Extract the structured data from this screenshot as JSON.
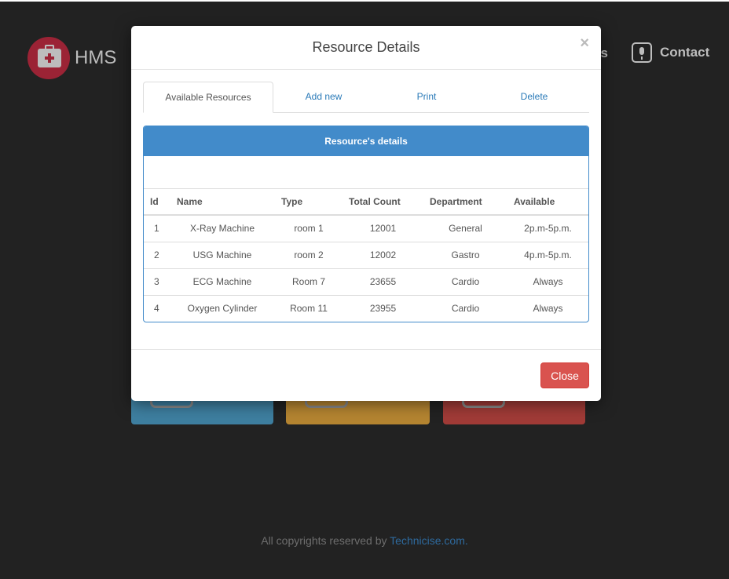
{
  "app": {
    "brand": "HMS"
  },
  "nav": {
    "services_partial": "es",
    "contact": "Contact"
  },
  "footer": {
    "text": "All copyrights reserved by ",
    "link": "Technicise.com."
  },
  "modal": {
    "title": "Resource Details",
    "close_symbol": "×",
    "tabs": [
      {
        "label": "Available Resources",
        "active": true
      },
      {
        "label": "Add new",
        "active": false
      },
      {
        "label": "Print",
        "active": false
      },
      {
        "label": "Delete",
        "active": false
      }
    ],
    "panel_heading": "Resource's details",
    "table": {
      "columns": [
        "Id",
        "Name",
        "Type",
        "Total Count",
        "Department",
        "Available"
      ],
      "rows": [
        [
          "1",
          "X-Ray Machine",
          "room 1",
          "12001",
          "General",
          "2p.m-5p.m."
        ],
        [
          "2",
          "USG Machine",
          "room 2",
          "12002",
          "Gastro",
          "4p.m-5p.m."
        ],
        [
          "3",
          "ECG Machine",
          "Room 7",
          "23655",
          "Cardio",
          "Always"
        ],
        [
          "4",
          "Oxygen Cylinder",
          "Room 11",
          "23955",
          "Cardio",
          "Always"
        ]
      ]
    },
    "footer_button": "Close"
  },
  "colors": {
    "primary": "#428bca",
    "danger": "#d9534f",
    "backdrop": "#222222",
    "brand": "#9b2335"
  },
  "icons": {
    "brand": "medical-briefcase-icon",
    "contact": "microphone-icon",
    "close": "close-icon"
  }
}
